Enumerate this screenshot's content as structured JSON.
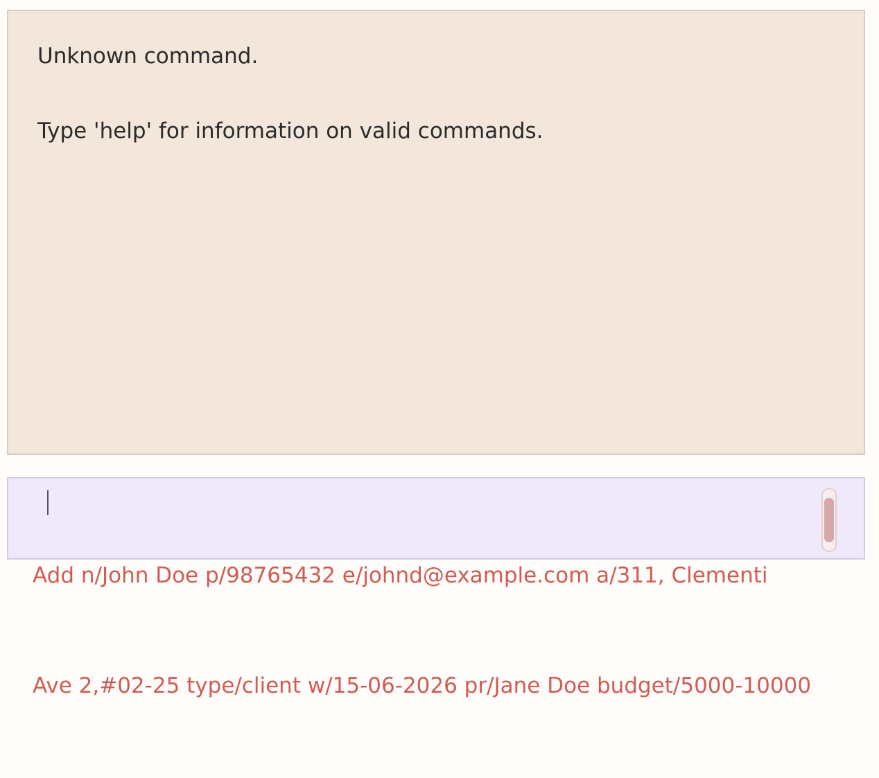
{
  "result_display": {
    "line1": "Unknown command.",
    "line2": "Type 'help' for information on valid commands."
  },
  "command_box": {
    "value_line1": "Add n/John Doe p/98765432 e/johnd@example.com a/311, Clementi",
    "value_line2": "Ave 2,#02-25 type/client w/15-06-2026 pr/Jane Doe budget/5000-10000"
  },
  "colors": {
    "result_bg": "#f3e7db",
    "command_bg": "#efe9fb",
    "command_text": "#cd5d55",
    "result_text": "#2b2b2b"
  }
}
